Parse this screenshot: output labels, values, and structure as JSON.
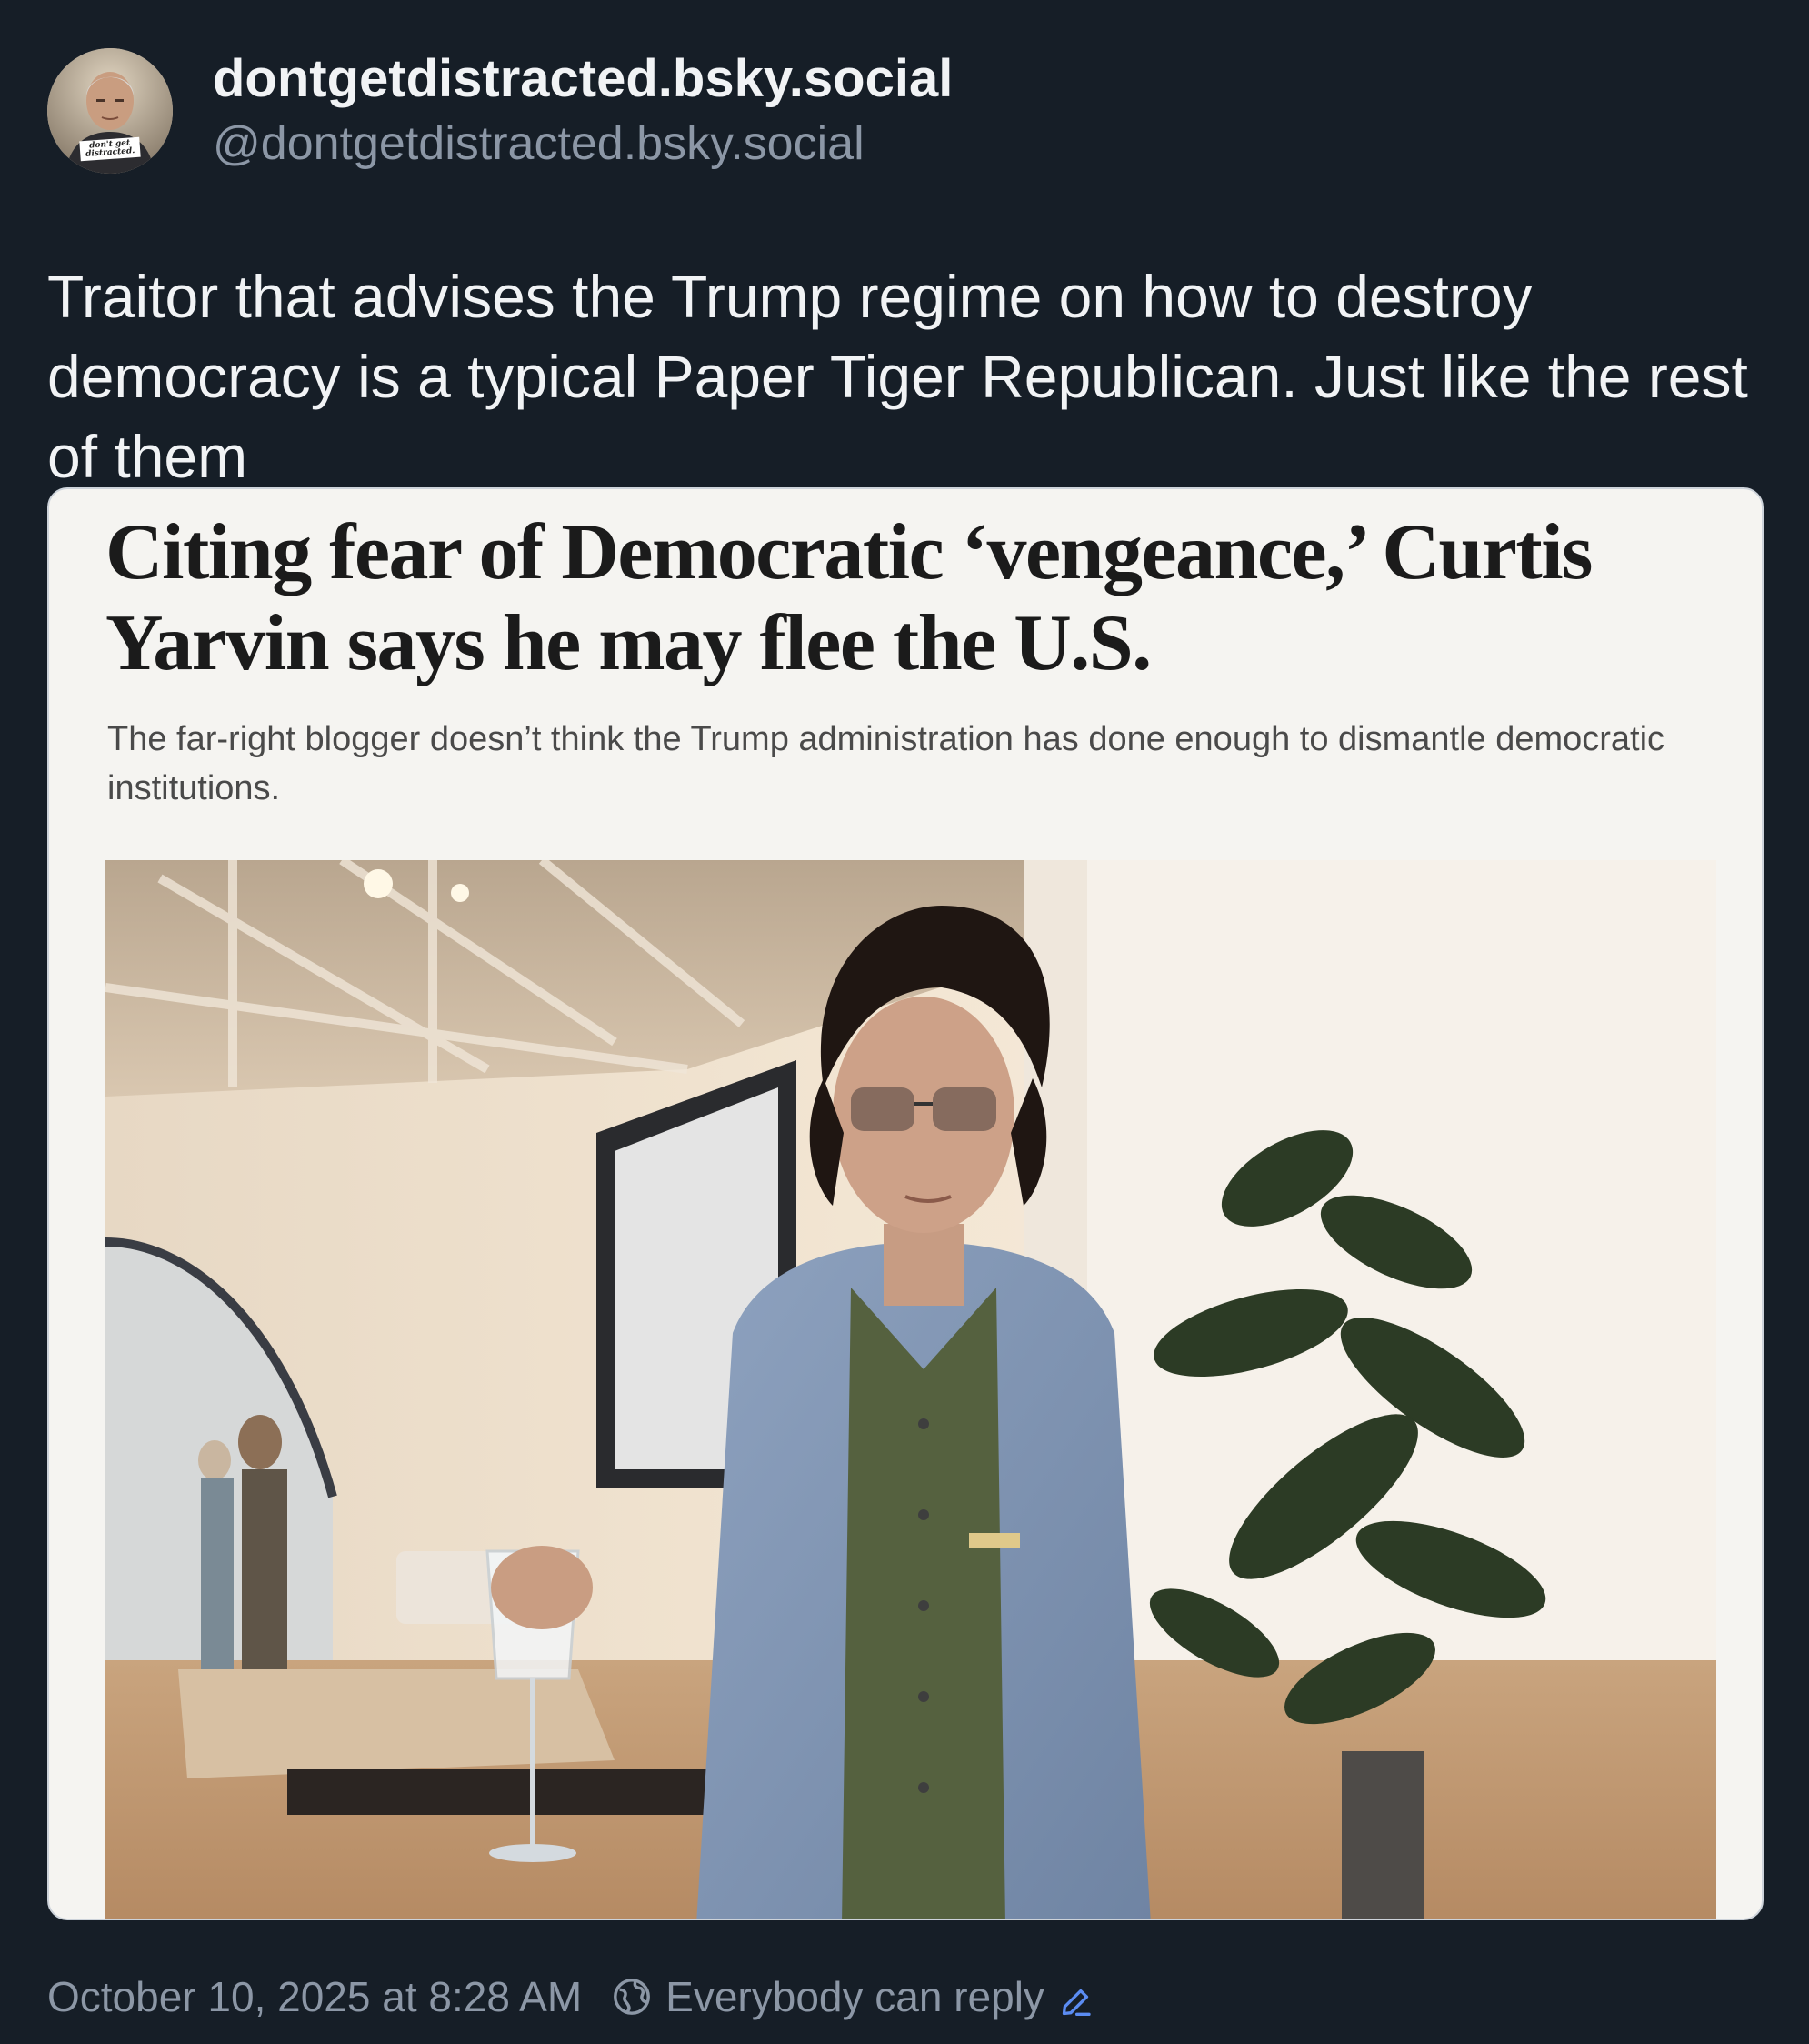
{
  "post": {
    "author": {
      "display_name": "dontgetdistracted.bsky.social",
      "handle": "@dontgetdistracted.bsky.social",
      "avatar_caption": "don't get distracted."
    },
    "text": "Traitor that advises the Trump regime on how to destroy democracy is a typical Paper Tiger Republican. Just like the rest of them",
    "embed": {
      "headline": "Citing fear of Democratic ‘vengeance,’ Curtis Yarvin says he may flee the U.S.",
      "dek": "The far-right blogger doesn’t think the Trump administration has done enough to dismantle democratic institutions."
    },
    "footer": {
      "timestamp": "October 10, 2025 at 8:28 AM",
      "reply_setting": "Everybody can reply"
    }
  },
  "icons": {
    "globe": "globe-icon",
    "edit": "pencil-icon"
  },
  "colors": {
    "background": "#161e27",
    "text_primary": "#f1f3f5",
    "text_secondary": "#8c97a6",
    "link_accent": "#5b8cf2"
  }
}
